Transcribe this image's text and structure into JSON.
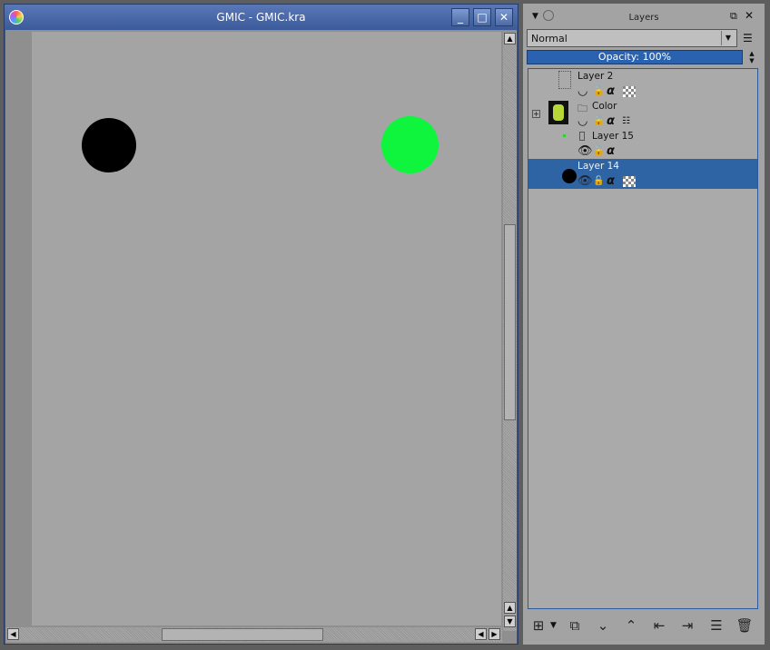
{
  "document_window": {
    "title": "GMIC - GMIC.kra",
    "buttons": {
      "minimize": "_",
      "maximize": "□",
      "close": "✕"
    },
    "canvas_shapes": [
      {
        "name": "black-circle",
        "color": "#000000"
      },
      {
        "name": "green-circle",
        "color": "#0ff53e"
      }
    ]
  },
  "layers_docker": {
    "title": "Layers",
    "blend_mode": "Normal",
    "opacity_label": "Opacity:  100%",
    "layers": [
      {
        "name": "Layer 2",
        "type": "paint",
        "visible": false,
        "selected": false
      },
      {
        "name": "Color",
        "type": "group",
        "visible": false,
        "selected": false
      },
      {
        "name": "Layer 15",
        "type": "paint",
        "visible": true,
        "selected": false
      },
      {
        "name": "Layer 14",
        "type": "paint",
        "visible": true,
        "selected": true
      }
    ],
    "bottom_buttons": [
      "add-layer",
      "duplicate-layer",
      "move-down",
      "move-up",
      "move-out",
      "move-in",
      "layer-properties",
      "delete-layer"
    ]
  },
  "colors": {
    "selection": "#2f64a4",
    "titlebar": "#3b5a9a"
  }
}
